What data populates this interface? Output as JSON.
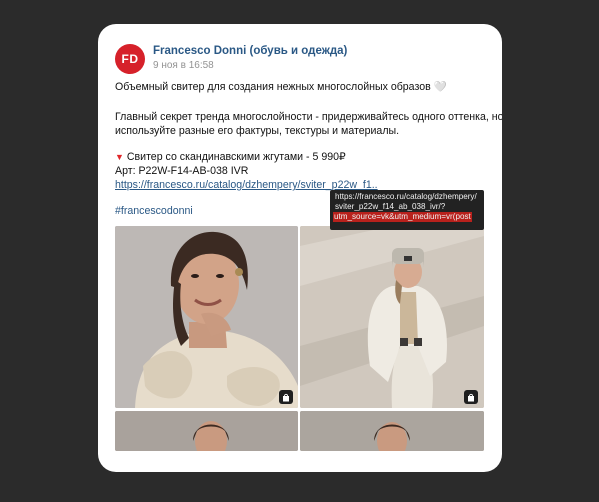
{
  "post": {
    "author": "Francesco Donni (обувь и одежда)",
    "avatar_text": "FD",
    "date": "9 ноя в 16:58",
    "line1": "Объемный свитер для создания нежных многослойных образов",
    "line2": "Главный секрет тренда многослойности - придерживайтесь одного оттенка, но",
    "line3": "используйте разные его фактуры, текстуры и материалы.",
    "product_name": "Свитер со скандинавскими жгутами - 5 990₽",
    "article": "Арт: P22W-F14-AB-038 IVR",
    "link_text": "https://francesco.ru/catalog/dzhempery/sviter_p22w_f1..",
    "hashtag": "#francescodonni"
  },
  "tooltip": {
    "line1": "https://francesco.ru/catalog/dzhempery/",
    "line2": "sviter_p22w_f14_ab_038_ivr/?",
    "line3": "utm_source=vk&utm_medium=vr(post"
  },
  "colors": {
    "link": "#2a5885",
    "avatar_bg": "#d6212a",
    "tooltip_highlight": "#b8211c"
  }
}
